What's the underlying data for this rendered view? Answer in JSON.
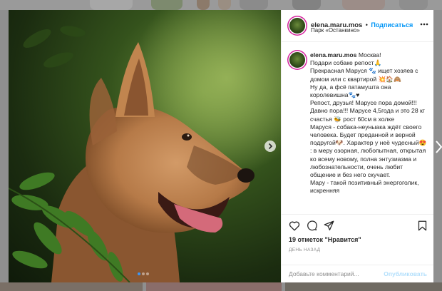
{
  "post": {
    "username": "elena.maru.mos",
    "separator": "•",
    "follow_label": "Подписаться",
    "location": "Парк «Останкино»",
    "caption_user": "elena.maru.mos",
    "caption_lines": [
      "Москва!",
      "Подари собаке репост🙏",
      "Прекрасная Маруся 🐾 ищет хозяев с домом или с квартирой 💥🏠🙈",
      "Ну да, а фсё патамушта она королевишна🐾♥",
      "Репост, друзья! Марусе пора домой!!! Давно пора!!! Марусе 4,5года и это 28 кг счастья 🐝 рост 60см в холке",
      "Маруся - собака-неуныака ждёт своего человека. Будет преданной и верной подругой🐶. Характер у неё чудесный😍 : в меру озорная, любопытная, открытая ко всему новому, полна энтузиазма и любознательности, очень любит общение и без него скучает.",
      "Мару - такой позитивный энергоголик, искренняя"
    ],
    "likes": "19 отметок \"Нравится\"",
    "time_ago": "ДЕНЬ НАЗАД",
    "comment_placeholder": "Добавьте комментарий...",
    "publish_label": "Опубликовать",
    "carousel": {
      "slides": 3,
      "active": 1
    }
  },
  "colors": {
    "accent": "#0095f6",
    "publish_disabled": "#b2dffc",
    "text": "#262626",
    "muted": "#8e8e8e",
    "dot_active": "#3c96f5"
  },
  "icons": [
    "more-options-icon",
    "heart-icon",
    "comment-icon",
    "share-icon",
    "bookmark-icon",
    "chevron-right-icon",
    "emoji-icon"
  ]
}
